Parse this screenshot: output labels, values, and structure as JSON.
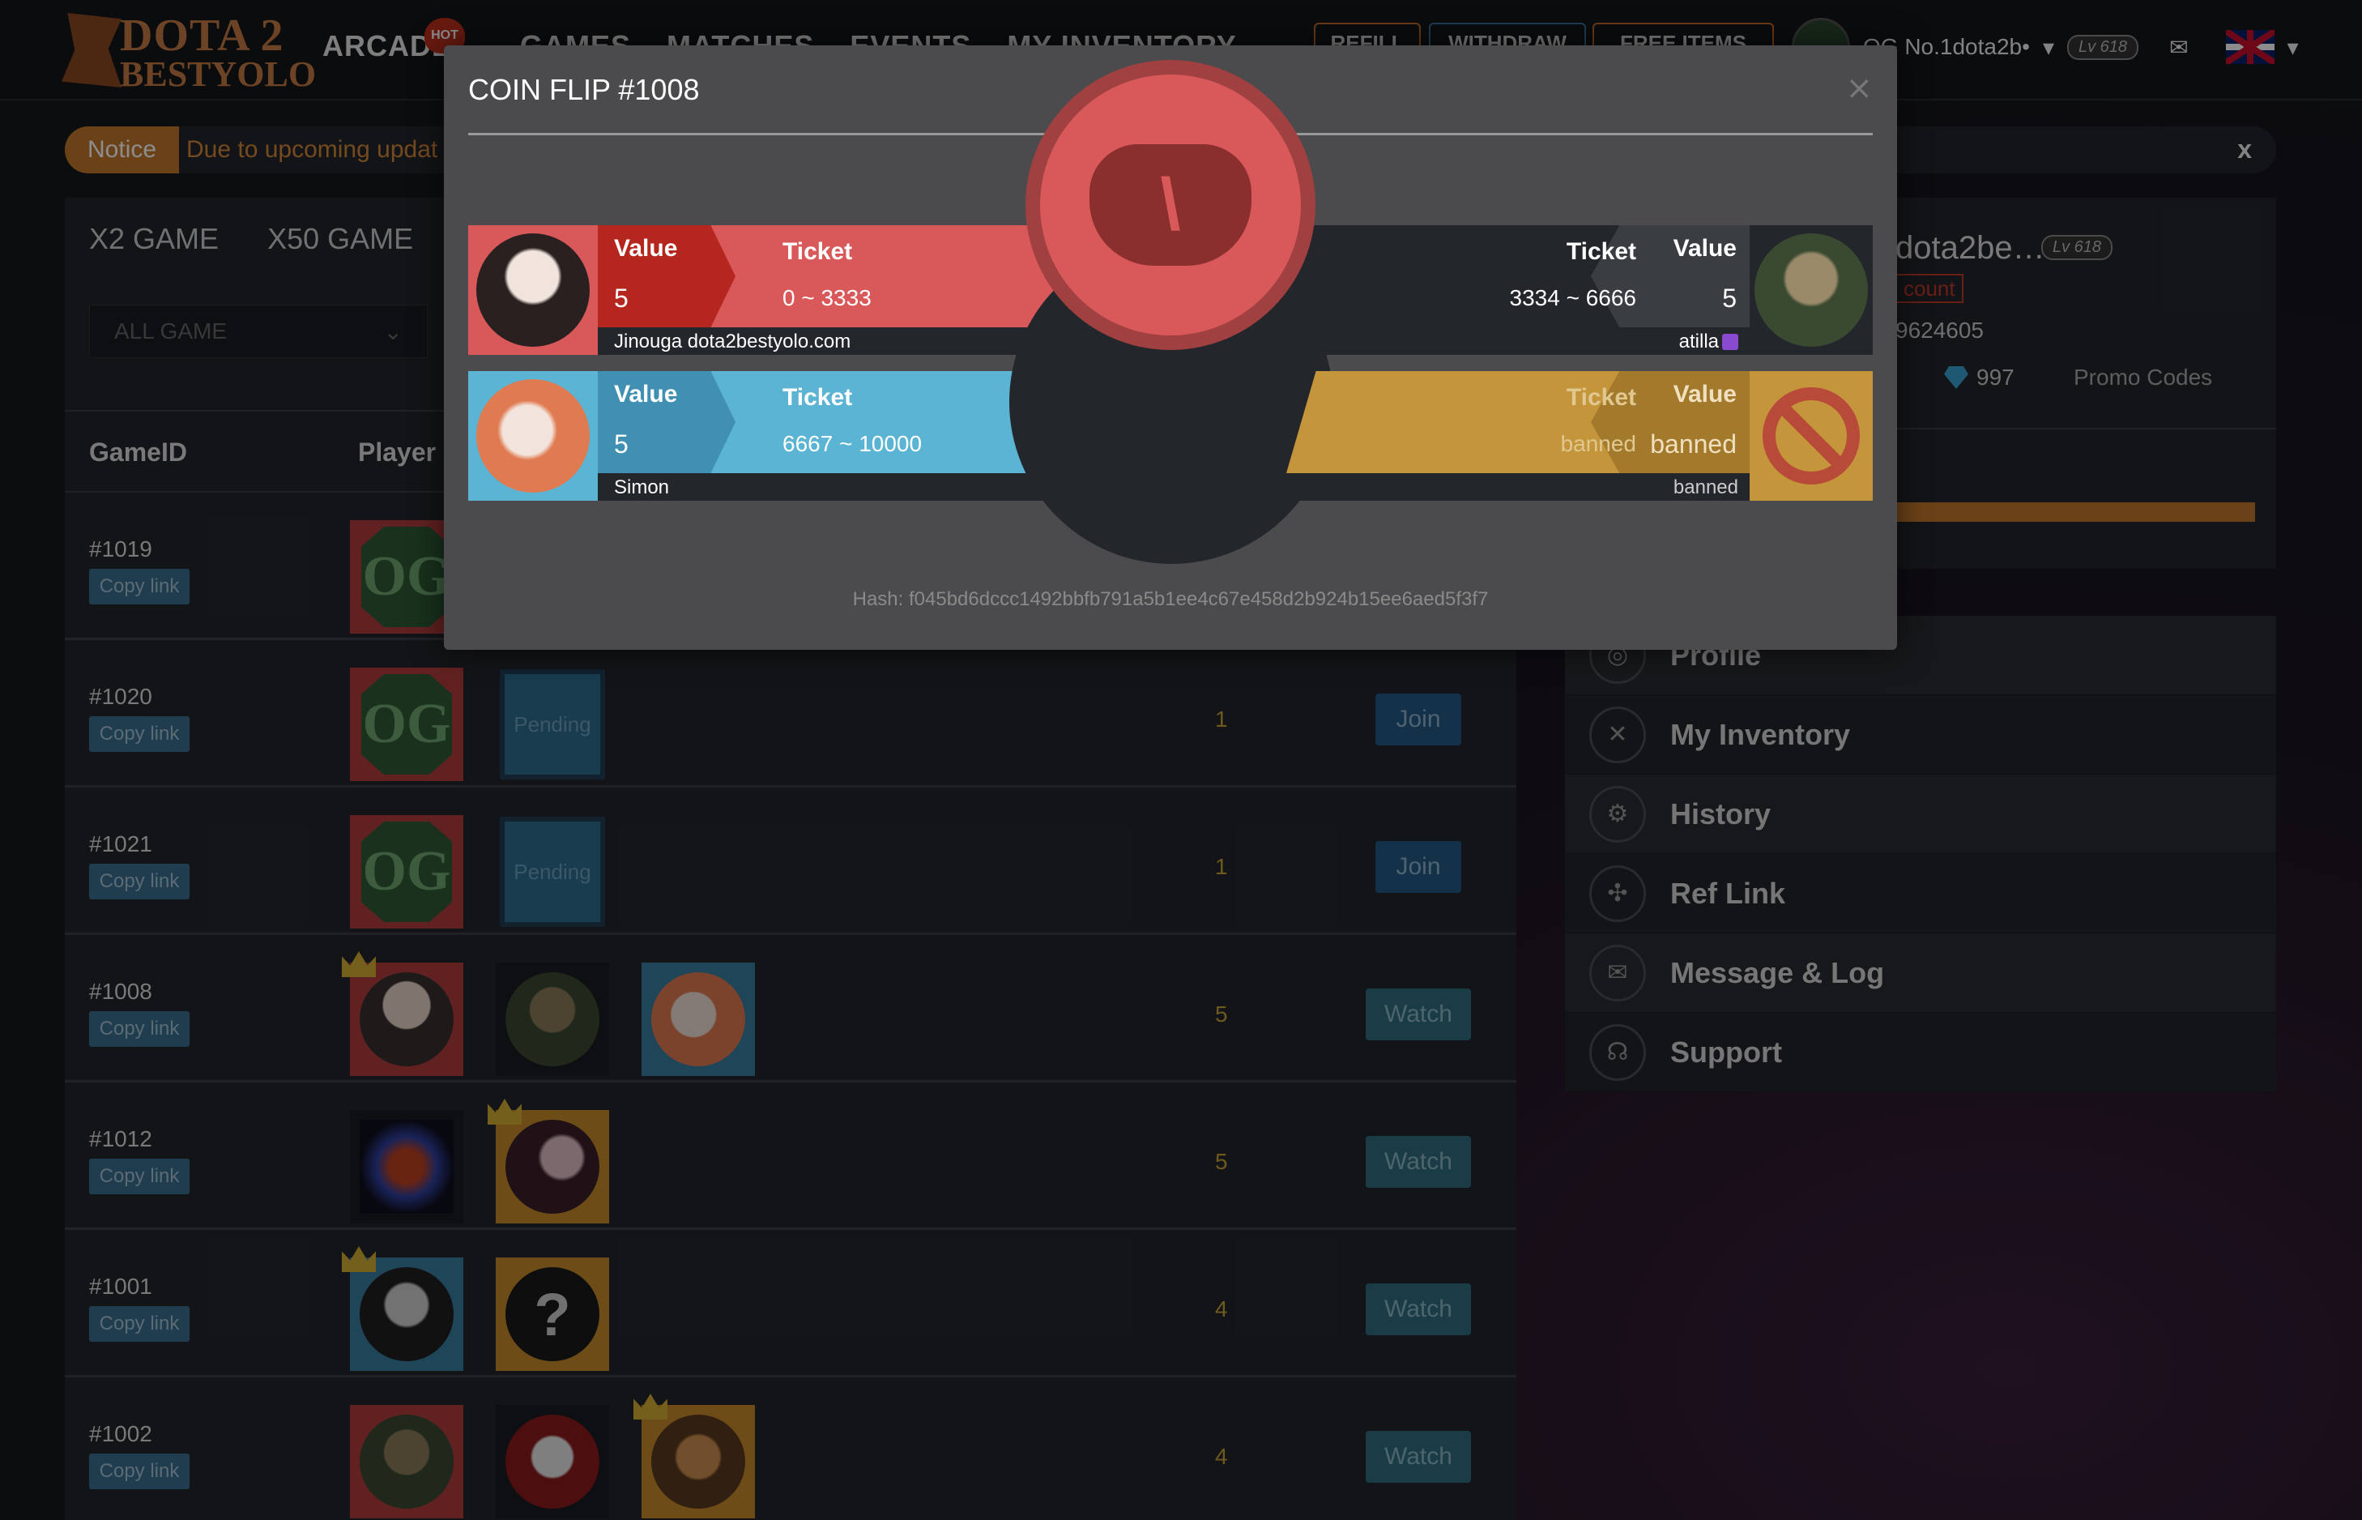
{
  "nav": {
    "logo_line1": "DOTA 2",
    "logo_line2": "BESTYOLO",
    "links": [
      "ARCADE",
      "GAMES",
      "MATCHES",
      "EVENTS",
      "MY INVENTORY"
    ],
    "hot_badge": "HOT",
    "buttons": [
      "REFILL",
      "WITHDRAW",
      "FREE ITEMS"
    ],
    "username": "OG No.1dota2b•",
    "level": "Lv 618"
  },
  "notice": {
    "tag": "Notice",
    "text": "Due to upcoming updat",
    "close": "x"
  },
  "games": {
    "tabs": [
      "X2 GAME",
      "X50 GAME"
    ],
    "filter_value": "ALL GAME",
    "columns": {
      "game_id": "GameID",
      "player": "Player"
    },
    "copy_label": "Copy link",
    "rows": [
      {
        "id": "#1019",
        "count": "",
        "action": ""
      },
      {
        "id": "#1020",
        "count": "1",
        "action": "Join",
        "pending": "Pending"
      },
      {
        "id": "#1021",
        "count": "1",
        "action": "Join",
        "pending": "Pending"
      },
      {
        "id": "#1008",
        "count": "5",
        "action": "Watch"
      },
      {
        "id": "#1012",
        "count": "5",
        "action": "Watch"
      },
      {
        "id": "#1001",
        "count": "4",
        "action": "Watch",
        "unknown": "?"
      },
      {
        "id": "#1002",
        "count": "4",
        "action": "Watch"
      }
    ]
  },
  "profile": {
    "name": "dota2be…",
    "level": "Lv 618",
    "account_tag": "count",
    "id": "9624605",
    "gems": "997",
    "promo": "Promo Codes"
  },
  "menu": {
    "items": [
      {
        "label": "Profile",
        "icon": "profile-icon"
      },
      {
        "label": "My Inventory",
        "icon": "inventory-icon"
      },
      {
        "label": "History",
        "icon": "history-icon"
      },
      {
        "label": "Ref Link",
        "icon": "ref-link-icon"
      },
      {
        "label": "Message & Log",
        "icon": "message-icon"
      },
      {
        "label": "Support",
        "icon": "support-icon"
      }
    ]
  },
  "modal": {
    "title": "COIN FLIP #1008",
    "close": "×",
    "players": [
      {
        "value_label": "Value",
        "value": "5",
        "ticket_label": "Ticket",
        "ticket": "0 ~ 3333",
        "name": "Jinouga dota2bestyolo.com"
      },
      {
        "value_label": "Value",
        "value": "5",
        "ticket_label": "Ticket",
        "ticket": "3334 ~ 6666",
        "name": "atilla"
      },
      {
        "value_label": "Value",
        "value": "5",
        "ticket_label": "Ticket",
        "ticket": "6667 ~ 10000",
        "name": "Simon"
      },
      {
        "value_label": "Value",
        "value": "banned",
        "ticket_label": "Ticket",
        "ticket": "banned",
        "name": "banned"
      }
    ],
    "hash": "Hash: f045bd6dccc1492bbfb791a5b1ee4c67e458d2b924b15ee6aed5f3f7"
  },
  "colors": {
    "accent": "#c4782c",
    "red_team": "#d9595a",
    "blue_team": "#5bb4d4",
    "gold_team": "#c4953a",
    "dark_strip": "#23262b"
  }
}
